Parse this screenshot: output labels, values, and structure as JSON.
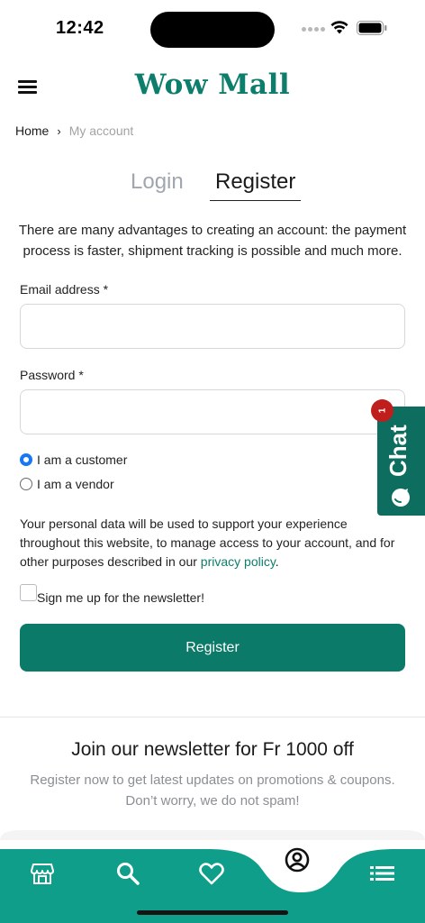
{
  "status": {
    "time": "12:42"
  },
  "brand": {
    "name": "Wow Mall",
    "color": "#0d7d6c"
  },
  "breadcrumb": {
    "home": "Home",
    "separator": "›",
    "current": "My account"
  },
  "tabs": {
    "login": "Login",
    "register": "Register",
    "active": "register"
  },
  "intro": "There are many advantages to creating an account: the payment process is faster, shipment tracking is possible and much more.",
  "form": {
    "email_label": "Email address *",
    "email_value": "",
    "password_label": "Password *",
    "password_value": "",
    "role_options": [
      "I am a customer",
      "I am a vendor"
    ],
    "role_selected": "I am a customer",
    "privacy_text": "Your personal data will be used to support your experience throughout this website, to manage access to your account, and for other purposes described in our",
    "privacy_link": "privacy policy",
    "privacy_end": ".",
    "newsletter_label": "Sign me up for the newsletter!",
    "newsletter_checked": false,
    "submit_label": "Register"
  },
  "newsletter": {
    "title": "Join our newsletter for Fr 1000 off",
    "text": "Register now to get latest updates on promotions & coupons. Don’t worry, we do not spam!"
  },
  "chat": {
    "label": "Chat",
    "badge": "1",
    "color": "#0d6e60"
  },
  "bottom_nav": {
    "items": [
      "store-icon",
      "search-icon",
      "heart-icon",
      "account-icon",
      "list-icon"
    ],
    "active": "account-icon",
    "color": "#0e9e8a"
  },
  "colors": {
    "accent": "#0c7a69",
    "radio": "#1877f2",
    "badge": "#c01d1d"
  }
}
